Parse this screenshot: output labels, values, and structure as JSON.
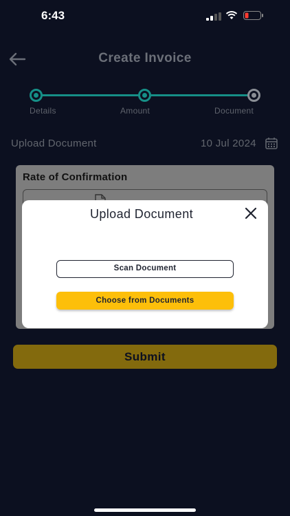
{
  "status_bar": {
    "time": "6:43"
  },
  "header": {
    "title": "Create Invoice"
  },
  "stepper": {
    "steps": [
      {
        "label": "Details",
        "state": "completed"
      },
      {
        "label": "Amount",
        "state": "completed"
      },
      {
        "label": "Document",
        "state": "inactive"
      }
    ],
    "active_color": "#168f87",
    "inactive_color": "#8a8e95"
  },
  "upload": {
    "label": "Upload Document",
    "date": "10 Jul 2024"
  },
  "card": {
    "title": "Rate of Confirmation"
  },
  "submit": {
    "label": "Submit"
  },
  "modal": {
    "title": "Upload Document",
    "scan_label": "Scan Document",
    "choose_label": "Choose from Documents"
  },
  "colors": {
    "background": "#0c1020",
    "accent": "#fdbf0a"
  }
}
